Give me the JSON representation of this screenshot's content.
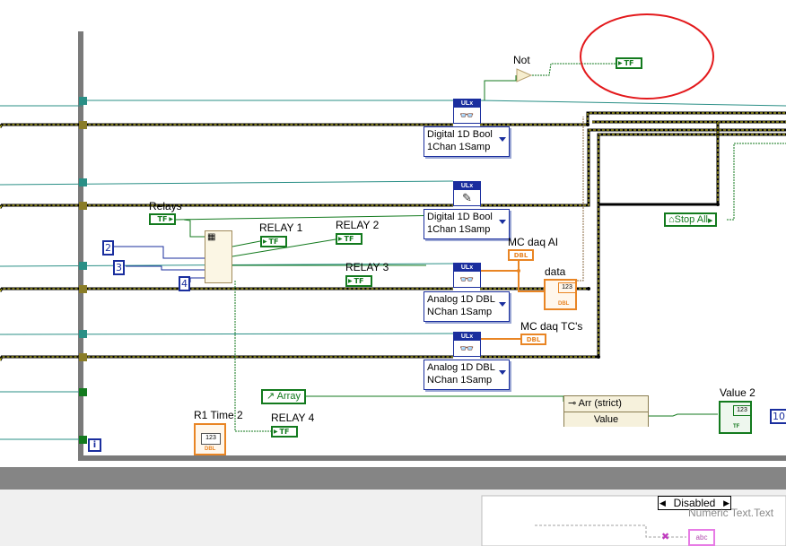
{
  "labels": {
    "not": "Not",
    "relays": "Relays",
    "relay1": "RELAY 1",
    "relay2": "RELAY 2",
    "relay3": "RELAY 3",
    "relay4": "RELAY 4",
    "mc_daq_ai": "MC daq AI",
    "mc_daq_tcs": "MC daq TC's",
    "data": "data",
    "r1_time2": "R1 Time 2",
    "value2": "Value 2",
    "numeric_text": "Numeric Text.Text"
  },
  "terminals": {
    "tf": "TF",
    "dbl": "DBL",
    "num123": "123",
    "abc": "abc",
    "iter": "i",
    "ulx": "ULx"
  },
  "constants": {
    "c2": "2",
    "c3": "3",
    "c4": "4",
    "c10": "10"
  },
  "daqmx_nodes": [
    {
      "line1": "Digital 1D Bool",
      "line2": "1Chan 1Samp"
    },
    {
      "line1": "Digital 1D Bool",
      "line2": "1Chan 1Samp"
    },
    {
      "line1": "Analog 1D DBL",
      "line2": "NChan 1Samp"
    },
    {
      "line1": "Analog 1D DBL",
      "line2": "NChan 1Samp"
    }
  ],
  "stop_all": "Stop All",
  "array_ref": "Array",
  "property_node": {
    "class": "Arr (strict)",
    "property": "Value"
  },
  "disabled_selector": "Disabled",
  "colors": {
    "boolean": "#137a1e",
    "numeric_int": "#1a2e9e",
    "numeric_dbl": "#e98524",
    "error_cluster": "#c8b400",
    "highlight_circle": "#e3191c"
  }
}
